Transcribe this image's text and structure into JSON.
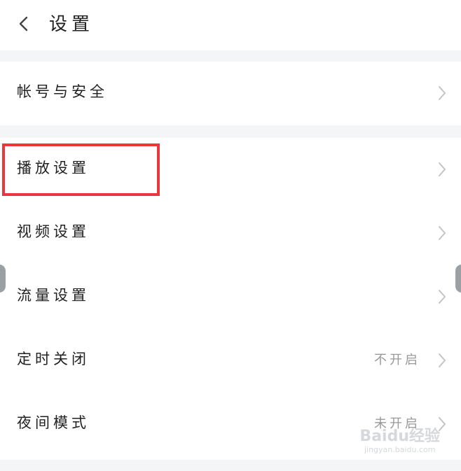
{
  "header": {
    "title": "设置",
    "back_icon": "chevron-left-icon"
  },
  "groups": [
    {
      "rows": [
        {
          "label": "帐号与安全",
          "value": ""
        }
      ]
    },
    {
      "rows": [
        {
          "label": "播放设置",
          "value": ""
        },
        {
          "label": "视频设置",
          "value": ""
        },
        {
          "label": "流量设置",
          "value": ""
        },
        {
          "label": "定时关闭",
          "value": "不开启"
        },
        {
          "label": "夜间模式",
          "value": "未开启"
        }
      ]
    }
  ],
  "annotation": {
    "highlight_color": "#e8383d",
    "highlighted_item": "播放设置"
  },
  "watermark": {
    "brand": "Baidu经验",
    "url": "jingyan.baidu.com"
  },
  "colors": {
    "background": "#f3f5f6",
    "surface": "#ffffff",
    "text": "#222222",
    "secondary_text": "#999999",
    "chevron": "#c4c4c4"
  }
}
